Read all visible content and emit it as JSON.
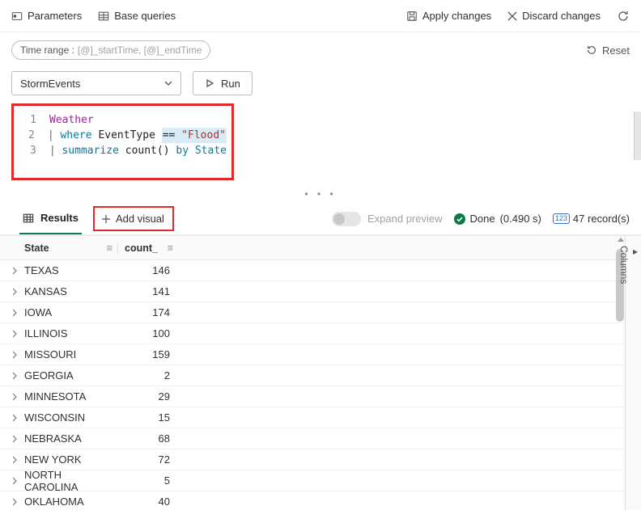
{
  "toolbar": {
    "parameters": "Parameters",
    "baseQueries": "Base queries",
    "applyChanges": "Apply changes",
    "discardChanges": "Discard changes"
  },
  "timeRange": {
    "label": "Time range :",
    "value": "[@]_startTime, [@]_endTime"
  },
  "reset": "Reset",
  "dataSourceSelect": "StormEvents",
  "runLabel": "Run",
  "code": {
    "line1": {
      "n": "1",
      "table": "Weather"
    },
    "line2": {
      "n": "2",
      "pipe": "| ",
      "kw": "where",
      "ident": " EventType ",
      "op": "==",
      "str": " \"Flood\""
    },
    "line3": {
      "n": "3",
      "pipe": "| ",
      "kw": "summarize",
      "fn": " count()",
      "by": " by ",
      "col": "State"
    }
  },
  "resultsTab": "Results",
  "addVisual": "Add visual",
  "expandPreview": "Expand preview",
  "status": {
    "label": "Done",
    "time": "(0.490 s)"
  },
  "recordCount": "47 record(s)",
  "columnsRail": "Columns",
  "columns": {
    "state": "State",
    "count": "count_"
  },
  "rows": [
    {
      "state": "TEXAS",
      "count": 146
    },
    {
      "state": "KANSAS",
      "count": 141
    },
    {
      "state": "IOWA",
      "count": 174
    },
    {
      "state": "ILLINOIS",
      "count": 100
    },
    {
      "state": "MISSOURI",
      "count": 159
    },
    {
      "state": "GEORGIA",
      "count": 2
    },
    {
      "state": "MINNESOTA",
      "count": 29
    },
    {
      "state": "WISCONSIN",
      "count": 15
    },
    {
      "state": "NEBRASKA",
      "count": 68
    },
    {
      "state": "NEW YORK",
      "count": 72
    },
    {
      "state": "NORTH CAROLINA",
      "count": 5
    },
    {
      "state": "OKLAHOMA",
      "count": 40
    }
  ]
}
